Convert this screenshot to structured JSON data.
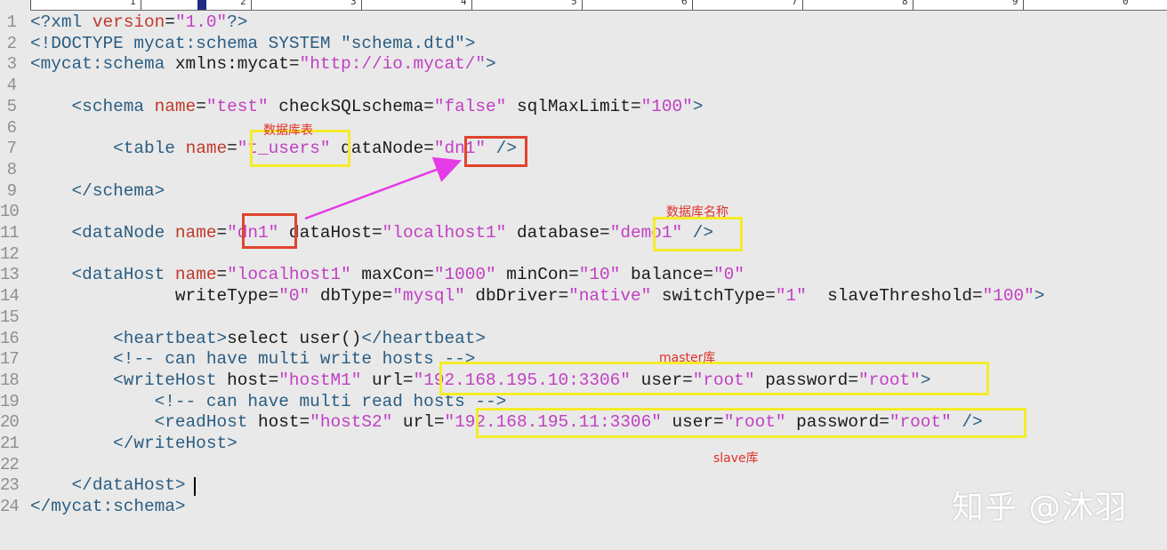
{
  "ruler": {
    "numbers": [
      "1",
      "2",
      "3",
      "4",
      "5",
      "6",
      "7",
      "8",
      "9",
      "0"
    ]
  },
  "editor": {
    "line_numbers": [
      "1",
      "2",
      "3",
      "4",
      "5",
      "6",
      "7",
      "8",
      "9",
      "10",
      "11",
      "12",
      "13",
      "14",
      "15",
      "16",
      "17",
      "18",
      "19",
      "20",
      "21",
      "22",
      "23",
      "24"
    ],
    "lines": [
      [
        [
          "tg",
          "<?xml "
        ],
        [
          "at",
          "version"
        ],
        [
          "tx",
          "="
        ],
        [
          "st",
          "\"1.0\""
        ],
        [
          "tg",
          "?>"
        ]
      ],
      [
        [
          "tg",
          "<!DOCTYPE mycat:schema SYSTEM \"schema.dtd\">"
        ]
      ],
      [
        [
          "tg",
          "<mycat:schema "
        ],
        [
          "tx",
          "xmlns:mycat="
        ],
        [
          "st",
          "\"http://io.mycat/\""
        ],
        [
          "tg",
          ">"
        ]
      ],
      [],
      [
        [
          "tx",
          "    "
        ],
        [
          "tg",
          "<schema "
        ],
        [
          "at",
          "name"
        ],
        [
          "tx",
          "="
        ],
        [
          "st",
          "\"test\""
        ],
        [
          "tx",
          " checkSQLschema="
        ],
        [
          "st",
          "\"false\""
        ],
        [
          "tx",
          " sqlMaxLimit="
        ],
        [
          "st",
          "\"100\""
        ],
        [
          "tg",
          ">"
        ]
      ],
      [],
      [
        [
          "tx",
          "        "
        ],
        [
          "tg",
          "<table "
        ],
        [
          "at",
          "name"
        ],
        [
          "tx",
          "="
        ],
        [
          "st",
          "\"t_users\""
        ],
        [
          "tx",
          " dataNode="
        ],
        [
          "st",
          "\"dn1\""
        ],
        [
          "tg",
          " />"
        ]
      ],
      [],
      [
        [
          "tx",
          "    "
        ],
        [
          "tg",
          "</schema>"
        ]
      ],
      [],
      [
        [
          "tx",
          "    "
        ],
        [
          "tg",
          "<dataNode "
        ],
        [
          "at",
          "name"
        ],
        [
          "tx",
          "="
        ],
        [
          "st",
          "\"dn1\""
        ],
        [
          "tx",
          " dataHost="
        ],
        [
          "st",
          "\"localhost1\""
        ],
        [
          "tx",
          " database="
        ],
        [
          "st",
          "\"demo1\""
        ],
        [
          "tg",
          " />"
        ]
      ],
      [],
      [
        [
          "tx",
          "    "
        ],
        [
          "tg",
          "<dataHost "
        ],
        [
          "at",
          "name"
        ],
        [
          "tx",
          "="
        ],
        [
          "st",
          "\"localhost1\""
        ],
        [
          "tx",
          " maxCon="
        ],
        [
          "st",
          "\"1000\""
        ],
        [
          "tx",
          " minCon="
        ],
        [
          "st",
          "\"10\""
        ],
        [
          "tx",
          " balance="
        ],
        [
          "st",
          "\"0\""
        ]
      ],
      [
        [
          "tx",
          "              writeType="
        ],
        [
          "st",
          "\"0\""
        ],
        [
          "tx",
          " dbType="
        ],
        [
          "st",
          "\"mysql\""
        ],
        [
          "tx",
          " dbDriver="
        ],
        [
          "st",
          "\"native\""
        ],
        [
          "tx",
          " switchType="
        ],
        [
          "st",
          "\"1\""
        ],
        [
          "tx",
          "  slaveThreshold="
        ],
        [
          "st",
          "\"100\""
        ],
        [
          "tg",
          ">"
        ]
      ],
      [],
      [
        [
          "tx",
          "        "
        ],
        [
          "tg",
          "<heartbeat>"
        ],
        [
          "tx",
          "select user()"
        ],
        [
          "tg",
          "</heartbeat>"
        ]
      ],
      [
        [
          "tx",
          "        "
        ],
        [
          "cm",
          "<!-- can have multi write hosts -->"
        ]
      ],
      [
        [
          "tx",
          "        "
        ],
        [
          "tg",
          "<writeHost "
        ],
        [
          "tx",
          "host="
        ],
        [
          "st",
          "\"hostM1\""
        ],
        [
          "tx",
          " url="
        ],
        [
          "st",
          "\"192.168.195.10:3306\""
        ],
        [
          "tx",
          " user="
        ],
        [
          "st",
          "\"root\""
        ],
        [
          "tx",
          " password="
        ],
        [
          "st",
          "\"root\""
        ],
        [
          "tg",
          ">"
        ]
      ],
      [
        [
          "tx",
          "            "
        ],
        [
          "cm",
          "<!-- can have multi read hosts -->"
        ]
      ],
      [
        [
          "tx",
          "            "
        ],
        [
          "tg",
          "<readHost "
        ],
        [
          "tx",
          "host="
        ],
        [
          "st",
          "\"hostS2\""
        ],
        [
          "tx",
          " url="
        ],
        [
          "st",
          "\"192.168.195.11:3306\""
        ],
        [
          "tx",
          " user="
        ],
        [
          "st",
          "\"root\""
        ],
        [
          "tx",
          " password="
        ],
        [
          "st",
          "\"root\""
        ],
        [
          "tg",
          " />"
        ]
      ],
      [
        [
          "tx",
          "        "
        ],
        [
          "tg",
          "</writeHost>"
        ]
      ],
      [],
      [
        [
          "tx",
          "    "
        ],
        [
          "tg",
          "</dataHost>"
        ]
      ],
      [
        [
          "tg",
          "</mycat:schema>"
        ]
      ]
    ]
  },
  "annotations": {
    "table_note": "数据库表",
    "database_note": "数据库名称",
    "master_note": "master库",
    "slave_note": "slave库"
  },
  "watermark": "知乎 @沐羽",
  "colors": {
    "tag": "#2a5d82",
    "attribute": "#c0392b",
    "string": "#c23fc3",
    "text": "#1b1b1b",
    "highlight_yellow": "#f4ec2a",
    "highlight_red": "#e0442e",
    "arrow": "#e53ae8",
    "annotation_text": "#e0322a"
  }
}
